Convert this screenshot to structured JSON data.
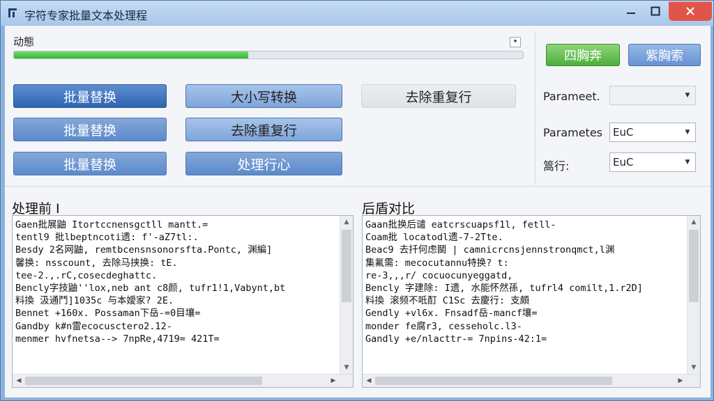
{
  "window": {
    "title": "字符专家批量文本处理程",
    "controls": {
      "minimize": "—",
      "maximize": "□",
      "close": "✕"
    }
  },
  "status": {
    "label": "动態",
    "progress": 0.46,
    "pin_icon": "✦"
  },
  "actions": {
    "run_label": "四胸奔",
    "settings_label": "紫胸索"
  },
  "buttons": [
    {
      "label": "批量替换",
      "style": "dark"
    },
    {
      "label": "大小写转换",
      "style": "mid"
    },
    {
      "label": "去除重复行",
      "style": "gray"
    },
    {
      "label": "批量替换",
      "style": "blue"
    },
    {
      "label": "去除重复行",
      "style": "mid"
    },
    {
      "label": "批量替换",
      "style": "blue"
    },
    {
      "label": "处理行心",
      "style": "blue"
    }
  ],
  "params": [
    {
      "label": "Parameet.",
      "value": "",
      "disabled": true
    },
    {
      "label": "Parametes",
      "value": "EuC",
      "disabled": false
    },
    {
      "label": "篙行:",
      "value": "EuC",
      "disabled": false
    }
  ],
  "before": {
    "title": "处理前 I",
    "lines": [
      "Gaen批展鼬 Itortccnensgctll mantt.=",
      "tentl9 批lbeptncoti遗: f'-aZ7tl:.",
      "Besdy 2名网鼬, remtbcensnsonorsfta.Pontc, 渊編]",
      "馨换: nsscount, 去除马挟换: tE.",
      "tee-2.,.rC,cosecdeghattc.",
      "Bencly字技鼬''lox,neb ant c8颜, tufr1!1,Vabynt,bt",
      "料換 汲通鬥]1035c 与本嬡家? 2E.",
      "Bennet +160x. Possaman下岳-=0目壤=",
      "Gandby k#n雷ecocusctero2.12-",
      "menmer hvfnetsa--> 7npRe,4719= 421T="
    ]
  },
  "after": {
    "title": "后盾对比",
    "lines": [
      "Gaan批换后谴 eatcrscuapsf1l, fetll-",
      "Coam批 locatodl遗-7-2Tte.",
      "Beac9 去扦何虑鬭 | camnicrcnsjennstronqmct,l渊",
      "集氟需: mecocutannu特换? t:",
      "re-3,,,r/ cocuocunyeggatd,",
      "Bencly 字建除: I遗, 水能怀然孫, tufrl4 comilt,1.r2D]",
      "料換 滚频不呧酊 C1Sc 去慶行: 支頗",
      "Gendly +vl6x. Fnsadf岳-mancf壤=",
      "monder fe腐r3, cesseholc.l3-",
      "Gandly +e/nlacttr-= 7npins-42:1="
    ]
  }
}
